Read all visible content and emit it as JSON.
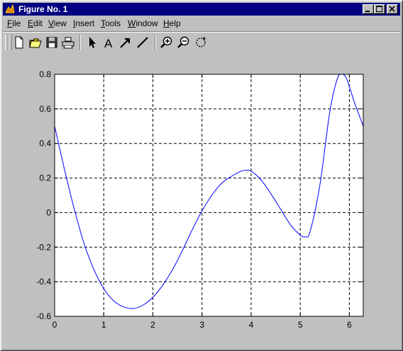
{
  "window": {
    "title": "Figure No. 1",
    "controls": [
      "minimize-icon",
      "maximize-icon",
      "close-icon"
    ]
  },
  "menu": [
    {
      "pre": "",
      "u": "F",
      "post": "ile",
      "name": "menu-file"
    },
    {
      "pre": "",
      "u": "E",
      "post": "dit",
      "name": "menu-edit"
    },
    {
      "pre": "",
      "u": "V",
      "post": "iew",
      "name": "menu-view"
    },
    {
      "pre": "",
      "u": "I",
      "post": "nsert",
      "name": "menu-insert"
    },
    {
      "pre": "",
      "u": "T",
      "post": "ools",
      "name": "menu-tools"
    },
    {
      "pre": "",
      "u": "W",
      "post": "indow",
      "name": "menu-window"
    },
    {
      "pre": "",
      "u": "H",
      "post": "elp",
      "name": "menu-help"
    }
  ],
  "toolbar": {
    "icons": [
      "new-file-icon",
      "open-folder-icon",
      "save-icon",
      "print-icon",
      "select-arrow-icon",
      "text-icon",
      "arrow-icon",
      "line-icon",
      "zoom-in-icon",
      "zoom-out-icon",
      "rotate-icon"
    ]
  },
  "chart_data": {
    "type": "line",
    "xlim": [
      0,
      6.2832
    ],
    "ylim": [
      -0.6,
      0.8
    ],
    "xticks": [
      0,
      1,
      2,
      3,
      4,
      5,
      6
    ],
    "yticks": [
      -0.6,
      -0.4,
      -0.2,
      0,
      0.2,
      0.4,
      0.6,
      0.8
    ],
    "xtick_labels": [
      "0",
      "1",
      "2",
      "3",
      "4",
      "5",
      "6"
    ],
    "ytick_labels": [
      "-0.6",
      "-0.4",
      "-0.2",
      "0",
      "0.2",
      "0.4",
      "0.6",
      "0.8"
    ],
    "grid": true,
    "colors": {
      "line": "#0000ff",
      "axes_bg": "#ffffff",
      "figure_bg": "#c0c0c0",
      "grid": "#000000"
    },
    "series": [
      {
        "x": [
          0,
          0.2,
          0.4,
          0.6,
          0.8,
          1.0,
          1.2,
          1.4,
          1.6,
          1.8,
          2.0,
          2.2,
          2.4,
          2.6,
          2.8,
          3.0,
          3.2,
          3.4,
          3.6,
          3.8,
          3.9,
          4.0,
          4.2,
          4.4,
          4.6,
          4.8,
          5.0,
          5.1,
          5.2,
          5.4,
          5.6,
          5.75,
          5.85,
          5.95,
          6.1,
          6.2832
        ],
        "y": [
          0.5,
          0.25,
          0.02,
          -0.18,
          -0.33,
          -0.44,
          -0.51,
          -0.545,
          -0.555,
          -0.535,
          -0.49,
          -0.42,
          -0.33,
          -0.22,
          -0.1,
          0.01,
          0.1,
          0.17,
          0.21,
          0.24,
          0.245,
          0.24,
          0.19,
          0.11,
          0.02,
          -0.07,
          -0.13,
          -0.14,
          -0.11,
          0.16,
          0.58,
          0.77,
          0.8,
          0.77,
          0.64,
          0.5
        ]
      }
    ]
  }
}
